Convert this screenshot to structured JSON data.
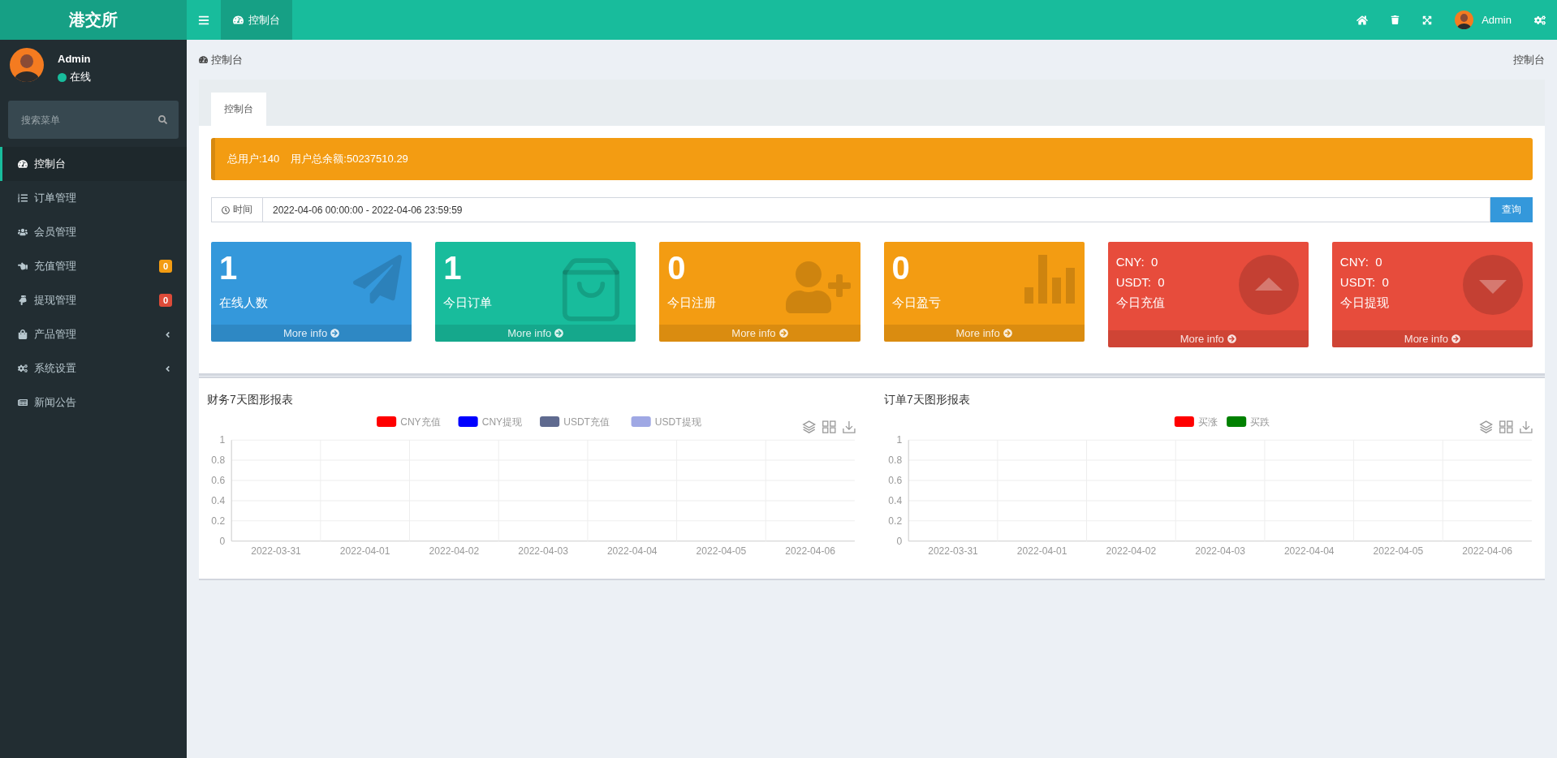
{
  "header": {
    "logo": "港交所",
    "nav_tabs": [
      {
        "label": "控制台",
        "selected": true
      }
    ],
    "user_name": "Admin"
  },
  "sidebar": {
    "user": {
      "name": "Admin",
      "status": "在线",
      "online": true
    },
    "search": {
      "placeholder": "搜索菜单"
    },
    "menu": [
      {
        "label": "控制台",
        "selected": true,
        "has_submenu": false
      },
      {
        "label": "订单管理",
        "selected": false,
        "has_submenu": false
      },
      {
        "label": "会员管理",
        "selected": false,
        "has_submenu": false
      },
      {
        "label": "充值管理",
        "selected": false,
        "has_submenu": false,
        "badge": "0",
        "color": "#f39c12"
      },
      {
        "label": "提现管理",
        "selected": false,
        "has_submenu": false,
        "badge": "0",
        "color": "#dd4b39"
      },
      {
        "label": "产品管理",
        "selected": false,
        "has_submenu": true
      },
      {
        "label": "系统设置",
        "selected": false,
        "has_submenu": true
      },
      {
        "label": "新闻公告",
        "selected": false,
        "has_submenu": false
      }
    ]
  },
  "breadcrumb": {
    "path": "控制台",
    "current": "控制台"
  },
  "tabs": [
    {
      "label": "控制台",
      "selected": true
    }
  ],
  "alert": {
    "items": [
      "总用户:140",
      "用户总余额:50237510.29"
    ]
  },
  "time_filter": {
    "label": "时间",
    "value": "2022-04-06 00:00:00 - 2022-04-06 23:59:59",
    "button": "查询"
  },
  "stat_boxes": [
    {
      "kind": "count",
      "value": "1",
      "label": "在线人数",
      "color": "#3498db",
      "link": "More info"
    },
    {
      "kind": "count",
      "value": "1",
      "label": "今日订单",
      "color": "#18bc9c",
      "link": "More info"
    },
    {
      "kind": "count",
      "value": "0",
      "label": "今日注册",
      "color": "#f39c12",
      "link": "More info"
    },
    {
      "kind": "count",
      "value": "0",
      "label": "今日盈亏",
      "color": "#f39c12",
      "link": "More info"
    },
    {
      "kind": "currency",
      "lines": [
        "CNY:  0",
        "USDT:  0"
      ],
      "label": "今日充值",
      "color": "#e74c3c",
      "link": "More info"
    },
    {
      "kind": "currency",
      "lines": [
        "CNY:  0",
        "USDT:  0"
      ],
      "label": "今日提现",
      "color": "#e74c3c",
      "link": "More info"
    }
  ],
  "charts": [
    {
      "title": "财务7天图形报表",
      "chart_data": {
        "type": "bar",
        "grid": true,
        "categories": [
          "2022-03-31",
          "2022-04-01",
          "2022-04-02",
          "2022-04-03",
          "2022-04-04",
          "2022-04-05",
          "2022-04-06"
        ],
        "ylim": [
          0,
          1
        ],
        "yticks": [
          0,
          0.2,
          0.4,
          0.6,
          0.8,
          1
        ],
        "series": [
          {
            "name": "CNY充值",
            "color": "#ff0000",
            "values": [
              0,
              0,
              0,
              0,
              0,
              0,
              0
            ]
          },
          {
            "name": "CNY提现",
            "color": "#0000ff",
            "values": [
              0,
              0,
              0,
              0,
              0,
              0,
              0
            ]
          },
          {
            "name": "USDT充值",
            "color": "#5f6a8f",
            "values": [
              0,
              0,
              0,
              0,
              0,
              0,
              0
            ]
          },
          {
            "name": "USDT提现",
            "color": "#9fa8e4",
            "values": [
              0,
              0,
              0,
              0,
              0,
              0,
              0
            ]
          }
        ]
      }
    },
    {
      "title": "订单7天图形报表",
      "chart_data": {
        "type": "bar",
        "grid": true,
        "categories": [
          "2022-03-31",
          "2022-04-01",
          "2022-04-02",
          "2022-04-03",
          "2022-04-04",
          "2022-04-05",
          "2022-04-06"
        ],
        "ylim": [
          0,
          1
        ],
        "yticks": [
          0,
          0.2,
          0.4,
          0.6,
          0.8,
          1
        ],
        "series": [
          {
            "name": "买涨",
            "color": "#ff0000",
            "values": [
              0,
              0,
              0,
              0,
              0,
              0,
              0
            ]
          },
          {
            "name": "买跌",
            "color": "#008000",
            "values": [
              0,
              0,
              0,
              0,
              0,
              0,
              0
            ]
          }
        ]
      }
    }
  ]
}
